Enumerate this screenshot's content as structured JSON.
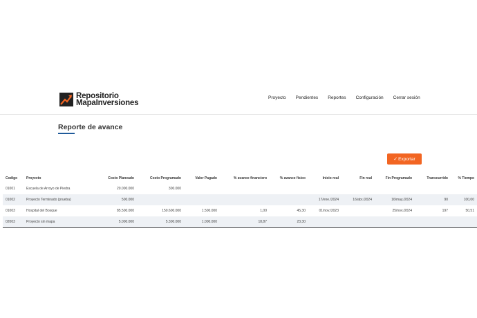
{
  "brand": {
    "line1": "Repositorio",
    "line2": "MapaInversiones"
  },
  "nav": [
    "Proyecto",
    "Pendientes",
    "Reportes",
    "Configuración",
    "Cerrar sesión"
  ],
  "page_title": "Reporte de avance",
  "export_label": "Exportar",
  "colors": {
    "accent": "#f26522",
    "underline": "#1f5a9a",
    "row_alt": "#eef1f5"
  },
  "table": {
    "headers": [
      "Codigo",
      "Proyecto",
      "Costo Planeado",
      "Costo Programado",
      "Valor Pagado",
      "% avance financiero",
      "% avance físico",
      "Inicio real",
      "Fin real",
      "Fin Programado",
      "Transcurrido",
      "% Tiempo"
    ],
    "rows": [
      [
        "01001",
        "Escuela de Arroyo de Piedra",
        "20.000.000",
        "300.000",
        "",
        "",
        "",
        "",
        "",
        "",
        "",
        ""
      ],
      [
        "01002",
        "Proyecto Terminado (prueba)",
        "500.000",
        "",
        "",
        "",
        "",
        "17/ene./2024",
        "16/abr./2024",
        "16/may./2024",
        "90",
        "100,00"
      ],
      [
        "01003",
        "Hospital del Bosque",
        "85.500.000",
        "150.600.000",
        "1.500.000",
        "1,00",
        "45,30",
        "01/nov./2023",
        "",
        "25/nov./2024",
        "197",
        "50,51"
      ],
      [
        "02003",
        "Proyecto sin mapa",
        "5.000.000",
        "5.300.000",
        "1.000.000",
        "18,87",
        "23,30",
        "",
        "",
        "",
        "",
        ""
      ]
    ]
  }
}
